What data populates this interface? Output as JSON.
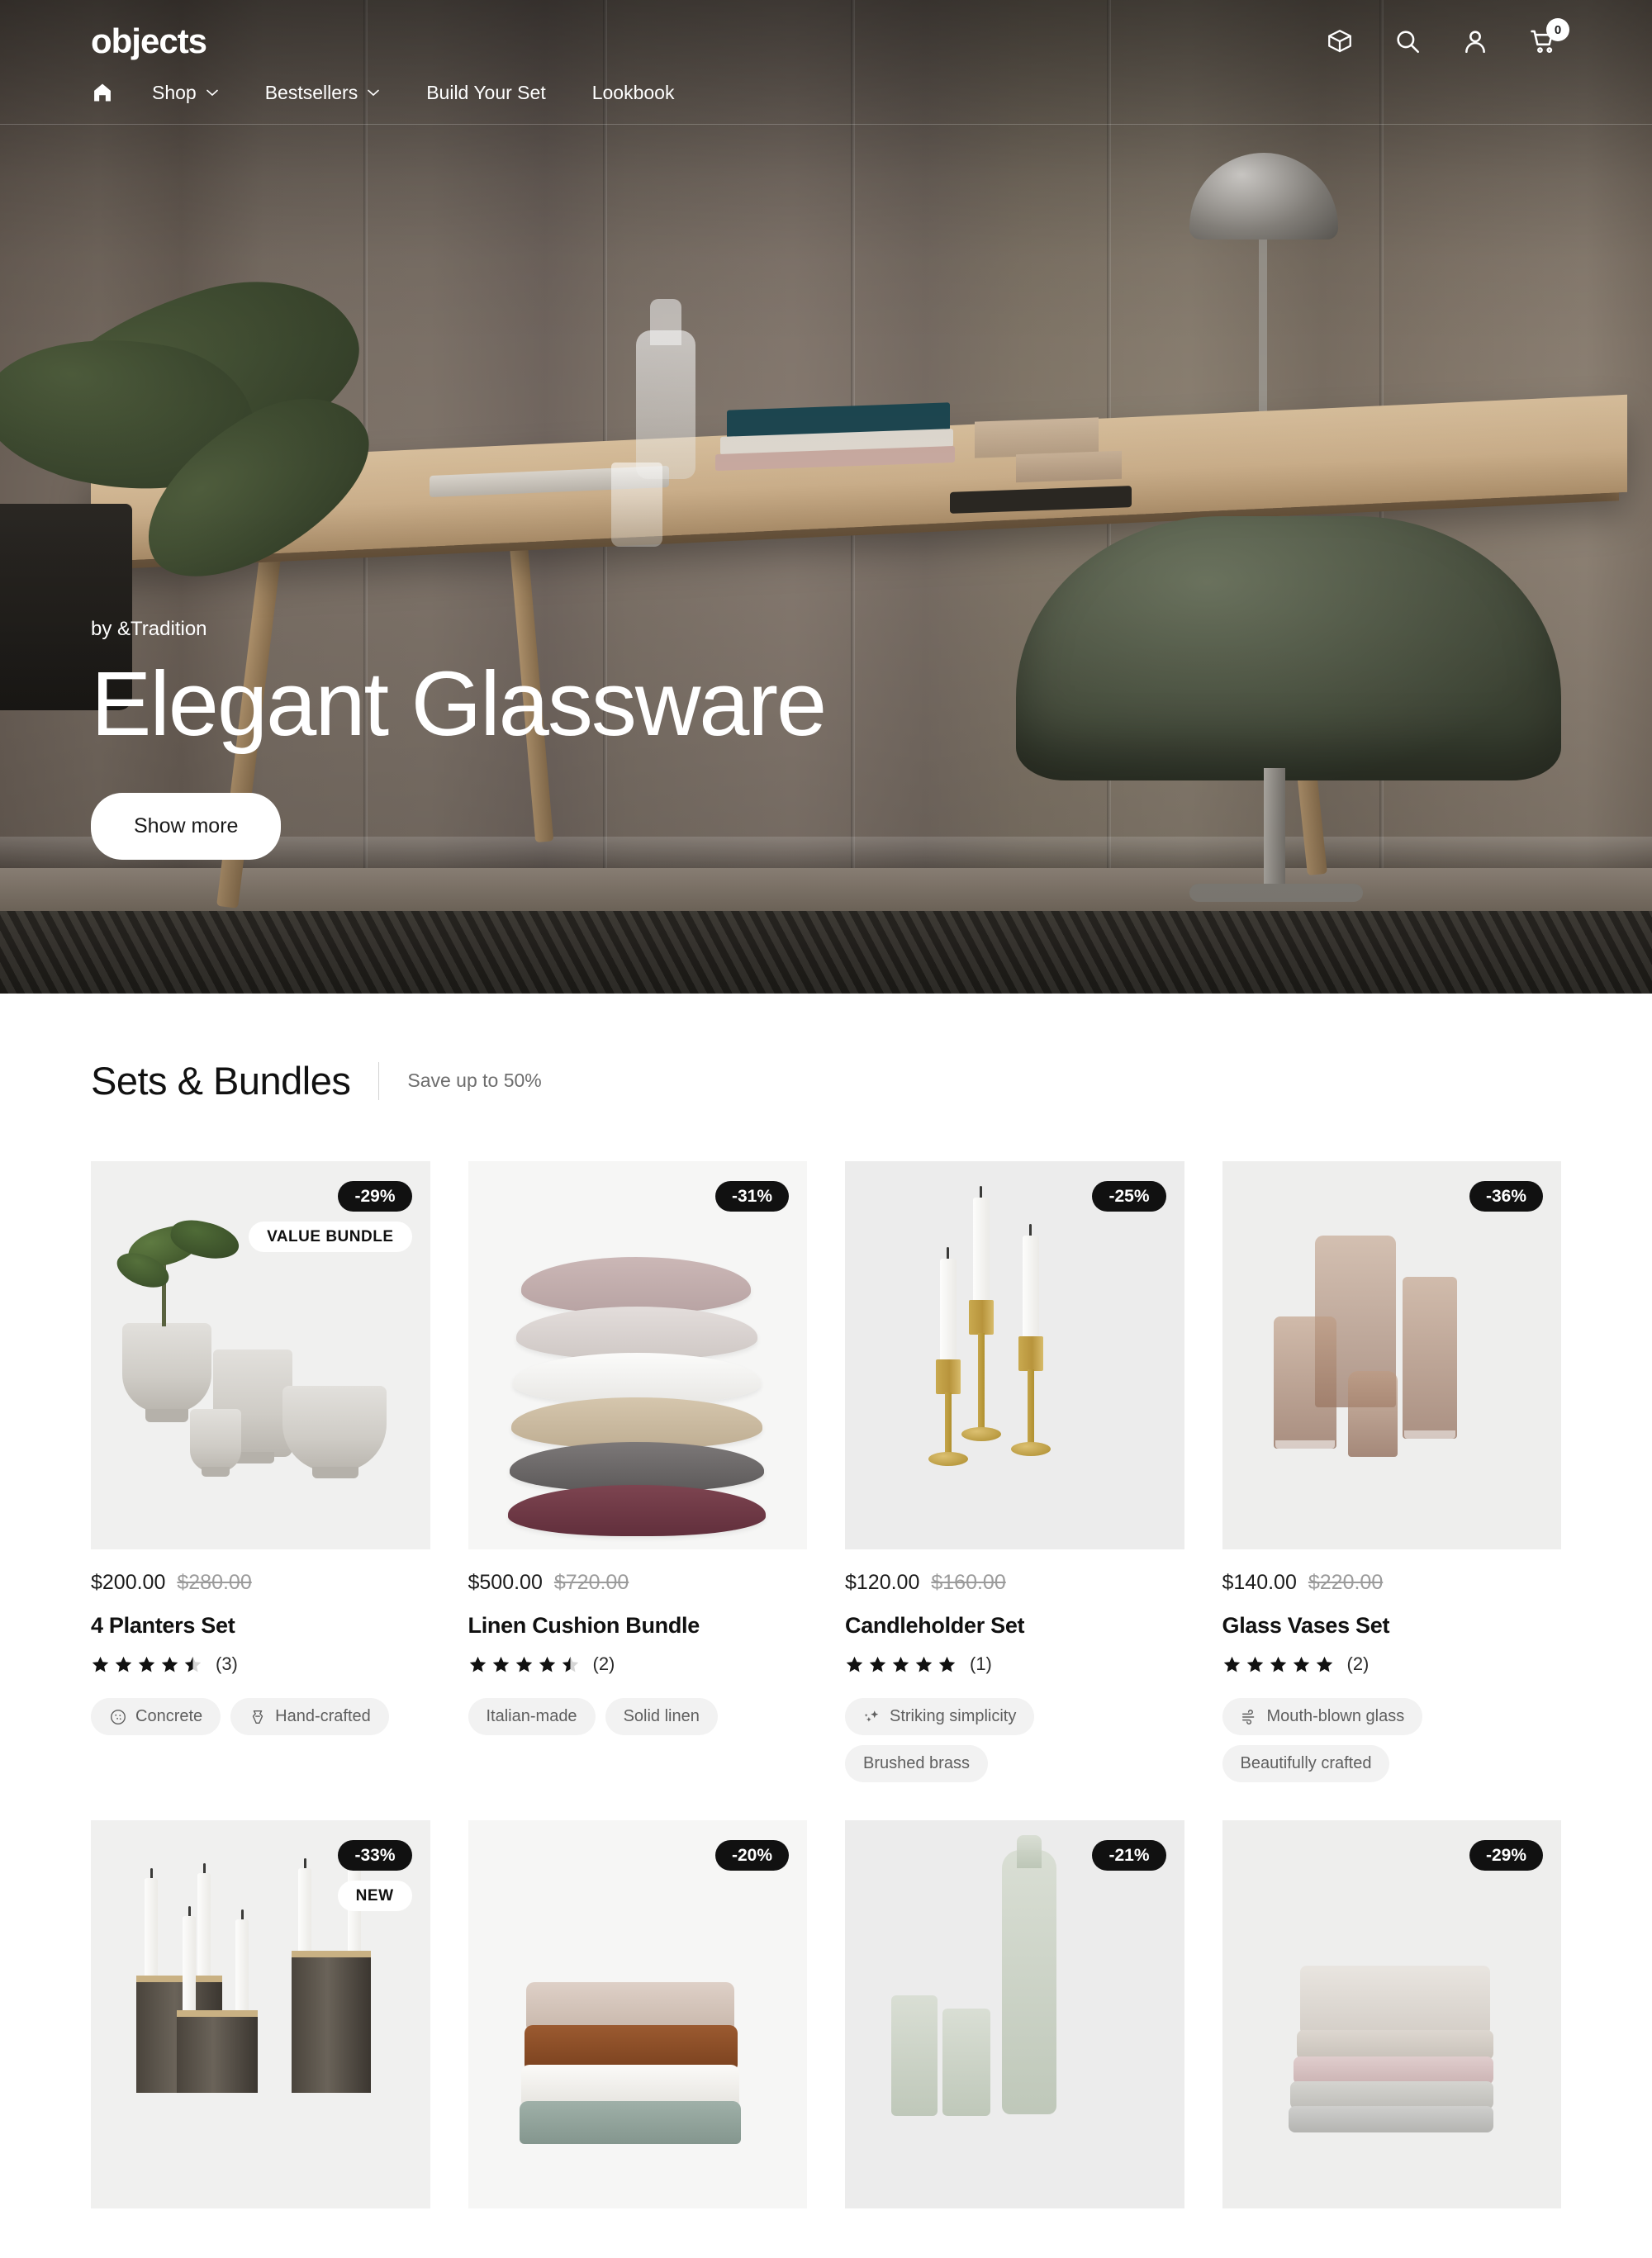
{
  "header": {
    "brand": "objects",
    "icons": [
      {
        "name": "package-icon",
        "label": "Package"
      },
      {
        "name": "search-icon",
        "label": "Search"
      },
      {
        "name": "account-icon",
        "label": "Account"
      },
      {
        "name": "cart-icon",
        "label": "Cart"
      }
    ],
    "cart_count": "0",
    "nav": [
      {
        "label": "Shop",
        "has_dropdown": true
      },
      {
        "label": "Bestsellers",
        "has_dropdown": true
      },
      {
        "label": "Build Your Set",
        "has_dropdown": false
      },
      {
        "label": "Lookbook",
        "has_dropdown": false
      }
    ]
  },
  "hero": {
    "kicker": "by &Tradition",
    "title": "Elegant Glassware",
    "cta": "Show more"
  },
  "section": {
    "title": "Sets & Bundles",
    "subtitle": "Save up to 50%"
  },
  "products": [
    {
      "discount": "-29%",
      "flag": "VALUE BUNDLE",
      "price": "$200.00",
      "price_old": "$280.00",
      "title": "4 Planters Set",
      "rating": 4.5,
      "reviews": "(3)",
      "tags": [
        {
          "label": "Concrete",
          "icon": "concrete-icon"
        },
        {
          "label": "Hand-crafted",
          "icon": "pottery-icon"
        }
      ]
    },
    {
      "discount": "-31%",
      "flag": "",
      "price": "$500.00",
      "price_old": "$720.00",
      "title": "Linen Cushion Bundle",
      "rating": 4.5,
      "reviews": "(2)",
      "tags": [
        {
          "label": "Italian-made",
          "icon": ""
        },
        {
          "label": "Solid linen",
          "icon": ""
        }
      ]
    },
    {
      "discount": "-25%",
      "flag": "",
      "price": "$120.00",
      "price_old": "$160.00",
      "title": "Candleholder Set",
      "rating": 5,
      "reviews": "(1)",
      "tags": [
        {
          "label": "Striking simplicity",
          "icon": "sparkle-icon"
        },
        {
          "label": "Brushed brass",
          "icon": ""
        }
      ]
    },
    {
      "discount": "-36%",
      "flag": "",
      "price": "$140.00",
      "price_old": "$220.00",
      "title": "Glass Vases Set",
      "rating": 5,
      "reviews": "(2)",
      "tags": [
        {
          "label": "Mouth-blown glass",
          "icon": "wind-icon"
        },
        {
          "label": "Beautifully crafted",
          "icon": ""
        }
      ]
    }
  ],
  "products_row2": [
    {
      "discount": "-33%",
      "flag": "NEW"
    },
    {
      "discount": "-20%",
      "flag": ""
    },
    {
      "discount": "-21%",
      "flag": ""
    },
    {
      "discount": "-29%",
      "flag": ""
    }
  ],
  "colors": {
    "accent": "#111111",
    "badge_bg": "#111111",
    "badge_text": "#ffffff",
    "tag_bg": "#f2f2f2",
    "page_bg": "#ffffff",
    "card_bg": "#efefef",
    "muted_text": "#6d6d6d"
  }
}
